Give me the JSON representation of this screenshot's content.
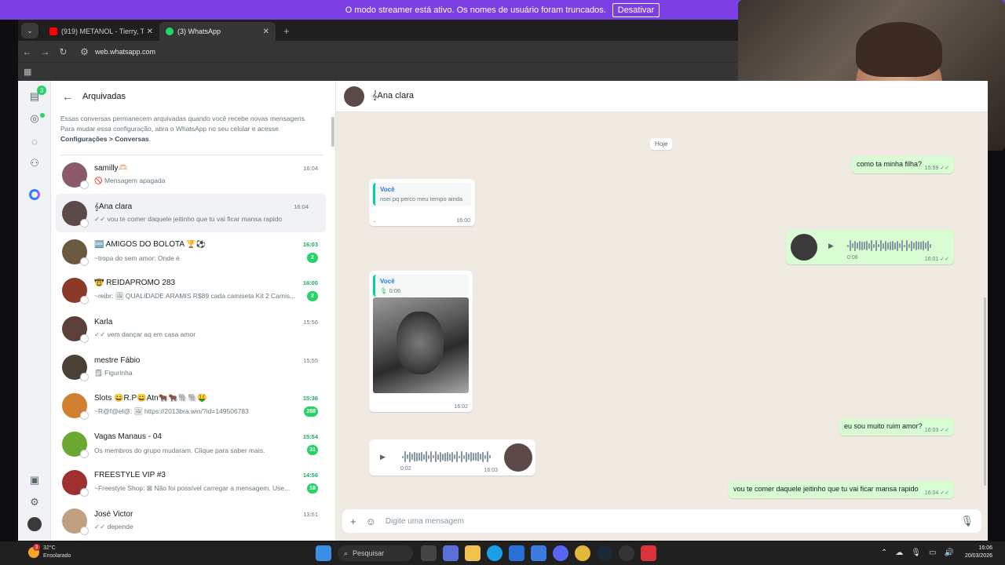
{
  "banner": {
    "text": "O modo streamer está ativo. Os nomes de usuário foram truncados.",
    "button": "Desativar"
  },
  "browser": {
    "tabs": [
      {
        "label": "(919) METANOL - Tierry, Toque"
      },
      {
        "label": "(3) WhatsApp"
      }
    ],
    "url": "web.whatsapp.com"
  },
  "rail": {
    "chats_badge": "3"
  },
  "sidebar": {
    "title": "Arquivadas",
    "info_text": "Essas conversas permanecem arquivadas quando você recebe novas mensagens. Para mudar essa configuração, abra o WhatsApp no seu celular e acesse ",
    "info_bold": "Configurações > Conversas",
    "info_end": ".",
    "chats": [
      {
        "name": "samilly🫶🏻",
        "time": "16:04",
        "preview": "🚫 Mensagem apagada",
        "badge": "",
        "avatar_color": "#8a5a6a"
      },
      {
        "name": "𝄞Ana clara",
        "time": "16:04",
        "preview": "✓✓ vou te comer daquele jeitinho que tu vai ficar mansa rapido",
        "badge": "",
        "avatar_color": "#5b4a48"
      },
      {
        "name": "🆒 AMIGOS DO BOLOTA 🏆⚽",
        "time": "16:03",
        "preview": "~tropa do sem amor: Onde é",
        "badge": "2",
        "avatar_color": "#6b5a40"
      },
      {
        "name": "🤠 REIDAPROMO 283",
        "time": "16:00",
        "preview": "~reibr: 🖼 QUALIDADE ARAMIS R$89 cada camiseta Kit 2 Camis...",
        "badge": "2",
        "avatar_color": "#8b3a2a"
      },
      {
        "name": "Karla",
        "time": "15:56",
        "preview": "✓✓ vem dançar aq em casa amor",
        "badge": "",
        "avatar_color": "#5a4037"
      },
      {
        "name": "mestre Fábio",
        "time": "15:55",
        "preview": "🗒 Figurinha",
        "badge": "",
        "avatar_color": "#4a4035"
      },
      {
        "name": "Slots 😀R.P😀Atn🐂🐂🐘🐘🤑",
        "time": "15:36",
        "preview": "~R@f@el@: 🖼 https://2013bra.win/?id=149506783",
        "badge": "288",
        "avatar_color": "#d08030"
      },
      {
        "name": "Vagas Manaus - 04",
        "time": "15:54",
        "preview": "Os membros do grupo mudaram. Clique para saber mais.",
        "badge": "31",
        "avatar_color": "#6aa830"
      },
      {
        "name": "FREESTYLE VIP #3",
        "time": "14:56",
        "preview": "~Freestyle Shop: ⊠ Não foi possível carregar a mensagem. Use...",
        "badge": "18",
        "avatar_color": "#a03030"
      },
      {
        "name": "José Victor",
        "time": "13:51",
        "preview": "✓✓ depende",
        "badge": "",
        "avatar_color": "#c0a080"
      }
    ]
  },
  "conversation": {
    "contact": "𝄞Ana clara",
    "day": "Hoje",
    "messages": {
      "m1_text": "como ta minha filha?",
      "m1_time": "15:59 ✓✓",
      "m2_quote_who": "Você",
      "m2_quote_text": "nsei pq perco meu tempo ainda",
      "m2_dot": ".",
      "m2_time": "16:00",
      "m3_dur": "0:06",
      "m3_time": "16:01 ✓✓",
      "m4_quote_who": "Você",
      "m4_quote_dur": "0:06",
      "m4_time": "16:02",
      "m5_text": "eu sou muito ruim amor?",
      "m5_time": "16:03 ✓✓",
      "m6_dur": "0:02",
      "m6_time": "16:03",
      "m7_text": "vou te comer daquele jeitinho que tu vai ficar mansa rapido",
      "m7_time": "16:04 ✓✓"
    },
    "input_placeholder": "Digite uma mensagem"
  },
  "taskbar": {
    "weather_notif": "3",
    "weather_temp": "32°C",
    "weather_desc": "Ensolarado",
    "search": "Pesquisar",
    "time": "16:06",
    "date": "20/03/2026"
  }
}
